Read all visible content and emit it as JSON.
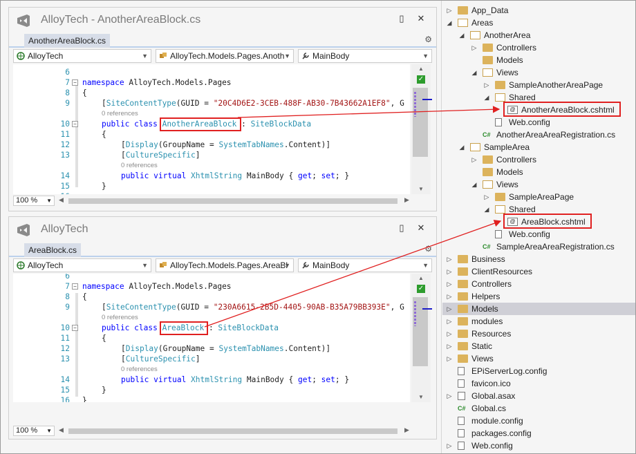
{
  "windows": [
    {
      "title": "AlloyTech - AnotherAreaBlock.cs",
      "tab": "AnotherAreaBlock.cs",
      "project_dropdown": "AlloyTech",
      "class_dropdown": "AlloyTech.Models.Pages.Anoth",
      "member_dropdown": "MainBody",
      "zoom": "100 %",
      "class_name": "AnotherAreaBlock",
      "guid": "\"20C4D6E2-3CEB-488F-AB30-7B43662A1EF8\""
    },
    {
      "title": "AlloyTech",
      "tab": "AreaBlock.cs",
      "project_dropdown": "AlloyTech",
      "class_dropdown": "AlloyTech.Models.Pages.AreaBl",
      "member_dropdown": "MainBody",
      "zoom": "100 %",
      "class_name": "AreaBlock",
      "guid": "\"230A6615-2B5D-4405-90AB-B35A79BB393E\""
    }
  ],
  "code": {
    "line_numbers": [
      "6",
      "7",
      "8",
      "9",
      "10",
      "11",
      "12",
      "13",
      "14",
      "15",
      "16"
    ],
    "namespace_kw": "namespace",
    "namespace_name": " AlloyTech.Models.Pages",
    "open_brace": "{",
    "close_brace": "}",
    "attr_open": "[",
    "site_content_type": "SiteContentType",
    "guid_prefix": "(GUID = ",
    "guid_suffix": ", G",
    "refs": "0 references",
    "public": "public",
    "class_kw": " class ",
    "colon": " : ",
    "base_class": "SiteBlockData",
    "display": "Display",
    "group_name": "(GroupName = ",
    "tab_names": "SystemTabNames",
    "content_suffix": ".Content)]",
    "culture_specific": "CultureSpecific",
    "attr_close": "]",
    "virtual_kw": " virtual ",
    "xhtml": "XhtmlString",
    "main_body": " MainBody { ",
    "get_kw": "get",
    "semi": "; ",
    "set_kw": "set",
    "prop_close": "; }"
  },
  "solution_explorer": {
    "items": [
      {
        "label": "App_Data",
        "kind": "folder"
      },
      {
        "label": "Areas",
        "kind": "folder-open"
      },
      {
        "label": "AnotherArea",
        "kind": "folder-open"
      },
      {
        "label": "Controllers",
        "kind": "folder"
      },
      {
        "label": "Models",
        "kind": "folder"
      },
      {
        "label": "Views",
        "kind": "folder-open"
      },
      {
        "label": "SampleAnotherAreaPage",
        "kind": "folder"
      },
      {
        "label": "Shared",
        "kind": "folder-open"
      },
      {
        "label": "AnotherAreaBlock.cshtml",
        "kind": "cshtml"
      },
      {
        "label": "Web.config",
        "kind": "config"
      },
      {
        "label": "AnotherAreaAreaRegistration.cs",
        "kind": "cs"
      },
      {
        "label": "SampleArea",
        "kind": "folder-open"
      },
      {
        "label": "Controllers",
        "kind": "folder"
      },
      {
        "label": "Models",
        "kind": "folder"
      },
      {
        "label": "Views",
        "kind": "folder-open"
      },
      {
        "label": "SampleAreaPage",
        "kind": "folder"
      },
      {
        "label": "Shared",
        "kind": "folder-open"
      },
      {
        "label": "AreaBlock.cshtml",
        "kind": "cshtml"
      },
      {
        "label": "Web.config",
        "kind": "config"
      },
      {
        "label": "SampleAreaAreaRegistration.cs",
        "kind": "cs"
      },
      {
        "label": "Business",
        "kind": "folder"
      },
      {
        "label": "ClientResources",
        "kind": "folder"
      },
      {
        "label": "Controllers",
        "kind": "folder"
      },
      {
        "label": "Helpers",
        "kind": "folder"
      },
      {
        "label": "Models",
        "kind": "folder"
      },
      {
        "label": "modules",
        "kind": "folder"
      },
      {
        "label": "Resources",
        "kind": "folder"
      },
      {
        "label": "Static",
        "kind": "folder"
      },
      {
        "label": "Views",
        "kind": "folder"
      },
      {
        "label": "EPiServerLog.config",
        "kind": "config"
      },
      {
        "label": "favicon.ico",
        "kind": "ico"
      },
      {
        "label": "Global.asax",
        "kind": "asax"
      },
      {
        "label": "Global.cs",
        "kind": "cs"
      },
      {
        "label": "module.config",
        "kind": "config"
      },
      {
        "label": "packages.config",
        "kind": "config"
      },
      {
        "label": "Web.config",
        "kind": "config"
      }
    ],
    "selected_label": "Models",
    "cs_glyph": "C#"
  },
  "colors": {
    "keyword": "#0000ff",
    "type": "#2b91af",
    "string": "#a31515",
    "highlight_box": "#e02020",
    "folder": "#dcb35c"
  }
}
